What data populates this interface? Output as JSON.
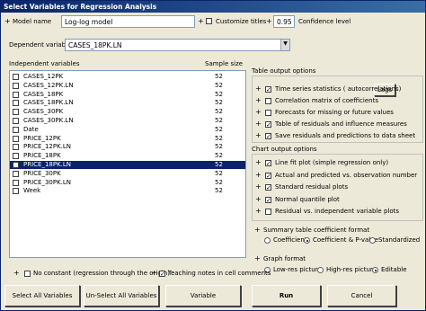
{
  "window": {
    "title": "Select Variables for Regression Analysis"
  },
  "header": {
    "model_name_label": "Model name",
    "model_name_value": "Log-log model",
    "customize_titles_label": "Customize titles",
    "confidence_value": "0.95",
    "confidence_label": "Confidence level"
  },
  "dependent": {
    "label": "Dependent variable",
    "value": "CASES_18PK.LN"
  },
  "variables": {
    "col_name": "Independent variables",
    "col_size": "Sample size",
    "items": [
      {
        "name": "CASES_12PK",
        "size": "52",
        "checked": false,
        "selected": false
      },
      {
        "name": "CASES_12PK.LN",
        "size": "52",
        "checked": false,
        "selected": false
      },
      {
        "name": "CASES_18PK",
        "size": "52",
        "checked": false,
        "selected": false
      },
      {
        "name": "CASES_18PK.LN",
        "size": "52",
        "checked": false,
        "selected": false
      },
      {
        "name": "CASES_30PK",
        "size": "52",
        "checked": false,
        "selected": false
      },
      {
        "name": "CASES_30PK.LN",
        "size": "52",
        "checked": false,
        "selected": false
      },
      {
        "name": "Date",
        "size": "52",
        "checked": false,
        "selected": false
      },
      {
        "name": "PRICE_12PK",
        "size": "52",
        "checked": false,
        "selected": false
      },
      {
        "name": "PRICE_12PK.LN",
        "size": "52",
        "checked": false,
        "selected": false
      },
      {
        "name": "PRICE_18PK",
        "size": "52",
        "checked": false,
        "selected": false
      },
      {
        "name": "PRICE_18PK.LN",
        "size": "52",
        "checked": true,
        "selected": true
      },
      {
        "name": "PRICE_30PK",
        "size": "52",
        "checked": false,
        "selected": false
      },
      {
        "name": "PRICE_30PK.LN",
        "size": "52",
        "checked": false,
        "selected": false
      },
      {
        "name": "Week",
        "size": "52",
        "checked": false,
        "selected": false
      }
    ]
  },
  "table_output": {
    "heading": "Table output options",
    "lags_button": "Lags",
    "options": [
      {
        "label": "Time series statistics ( autocorrelations)",
        "checked": true
      },
      {
        "label": "Correlation matrix of coefficients",
        "checked": false
      },
      {
        "label": "Forecasts for missing or future values",
        "checked": false
      },
      {
        "label": "Table of residuals and influence measures",
        "checked": true
      },
      {
        "label": "Save residuals and predictions to data sheet",
        "checked": true
      }
    ]
  },
  "chart_output": {
    "heading": "Chart output options",
    "options": [
      {
        "label": "Line fit plot (simple regression only)",
        "checked": true
      },
      {
        "label": "Actual and predicted vs. observation number",
        "checked": true
      },
      {
        "label": "Standard residual plots",
        "checked": true
      },
      {
        "label": "Normal quantile plot",
        "checked": true
      },
      {
        "label": "Residual vs. independent variable plots",
        "checked": false
      }
    ]
  },
  "coef_format": {
    "heading": "Summary table coefficient format",
    "options": [
      {
        "label": "Coefficient",
        "selected": false
      },
      {
        "label": "Coefficient & P-value",
        "selected": true
      },
      {
        "label": "Standardized",
        "selected": false
      }
    ]
  },
  "graph_format": {
    "heading": "Graph format",
    "options": [
      {
        "label": "Low-res picture",
        "selected": false
      },
      {
        "label": "High-res picture",
        "selected": false
      },
      {
        "label": "Editable",
        "selected": true
      }
    ]
  },
  "bottom": {
    "no_constant_label": "No constant (regression through the origin)",
    "no_constant_checked": false,
    "teaching_notes_label": "Teaching notes in cell comments",
    "teaching_notes_checked": true
  },
  "buttons": {
    "select_all": "Select All Variables",
    "unselect_all": "Un-Select All Variables",
    "variable_transformations": "Variable Transformations",
    "run": "Run",
    "cancel": "Cancel"
  }
}
